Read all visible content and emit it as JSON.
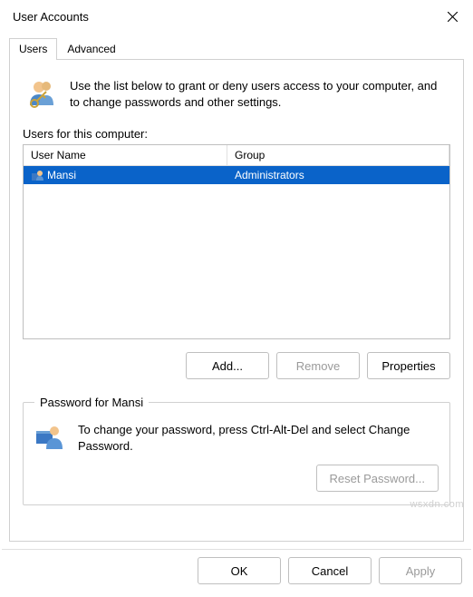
{
  "window": {
    "title": "User Accounts"
  },
  "tabs": {
    "users": "Users",
    "advanced": "Advanced"
  },
  "intro": {
    "text": "Use the list below to grant or deny users access to your computer, and to change passwords and other settings."
  },
  "usersSection": {
    "label": "Users for this computer:",
    "columns": {
      "name": "User Name",
      "group": "Group"
    },
    "rows": [
      {
        "name": "Mansi",
        "group": "Administrators"
      }
    ]
  },
  "buttons": {
    "add": "Add...",
    "remove": "Remove",
    "properties": "Properties"
  },
  "passwordGroup": {
    "legend": "Password for Mansi",
    "text": "To change your password, press Ctrl-Alt-Del and select Change Password.",
    "reset": "Reset Password..."
  },
  "footer": {
    "ok": "OK",
    "cancel": "Cancel",
    "apply": "Apply"
  },
  "watermark": "wsxdn.com"
}
